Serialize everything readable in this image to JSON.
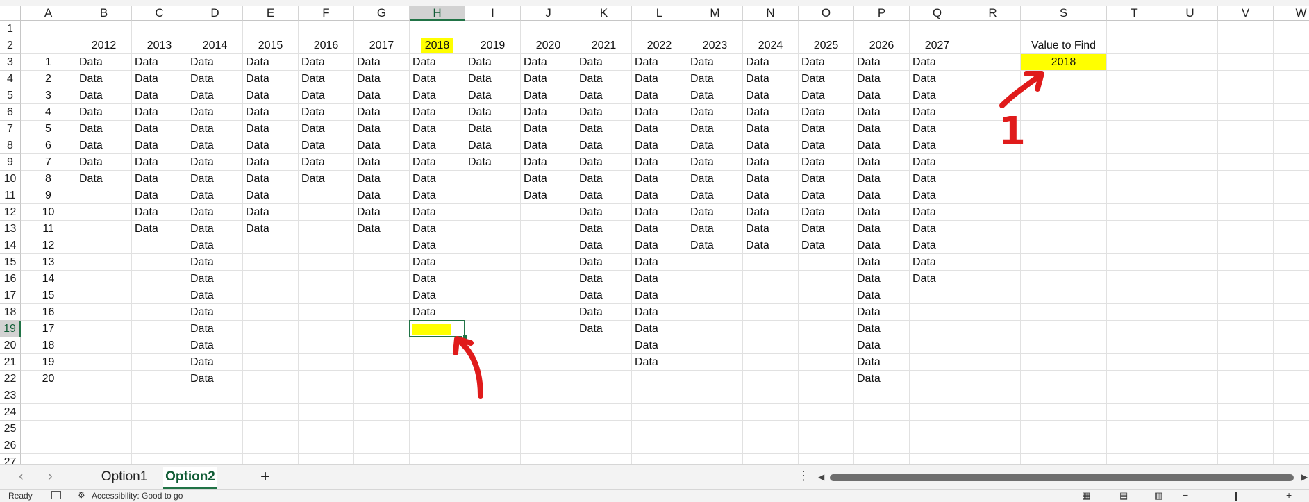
{
  "columns": [
    "A",
    "B",
    "C",
    "D",
    "E",
    "F",
    "G",
    "H",
    "I",
    "J",
    "K",
    "L",
    "M",
    "N",
    "O",
    "P",
    "Q",
    "R",
    "S",
    "T",
    "U",
    "V",
    "W"
  ],
  "rows": [
    "1",
    "2",
    "3",
    "4",
    "5",
    "6",
    "7",
    "8",
    "9",
    "10",
    "11",
    "12",
    "13",
    "14",
    "15",
    "16",
    "17",
    "18",
    "19",
    "20",
    "21",
    "22",
    "23",
    "24",
    "25",
    "26",
    "27"
  ],
  "selected_column": "H",
  "selected_row": "19",
  "years": [
    "2012",
    "2013",
    "2014",
    "2015",
    "2016",
    "2017",
    "2018",
    "2019",
    "2020",
    "2021",
    "2022",
    "2023",
    "2024",
    "2025",
    "2026",
    "2027"
  ],
  "index_values": [
    "1",
    "2",
    "3",
    "4",
    "5",
    "6",
    "7",
    "8",
    "9",
    "10",
    "11",
    "12",
    "13",
    "14",
    "15",
    "16",
    "17",
    "18",
    "19",
    "20"
  ],
  "data_label": "Data",
  "column_data_counts": [
    8,
    11,
    20,
    11,
    8,
    11,
    16,
    7,
    9,
    17,
    19,
    12,
    12,
    12,
    20,
    14
  ],
  "value_to_find": {
    "label": "Value to Find",
    "value": "2018"
  },
  "annotation_label": "1",
  "sheet_tabs": {
    "option1": "Option1",
    "option2": "Option2",
    "add": "+"
  },
  "status": {
    "ready": "Ready",
    "accessibility": "Accessibility: Good to go"
  },
  "highlight_color": "#ffff00",
  "accent_color": "#217346",
  "annotation_color": "#e01b1b"
}
